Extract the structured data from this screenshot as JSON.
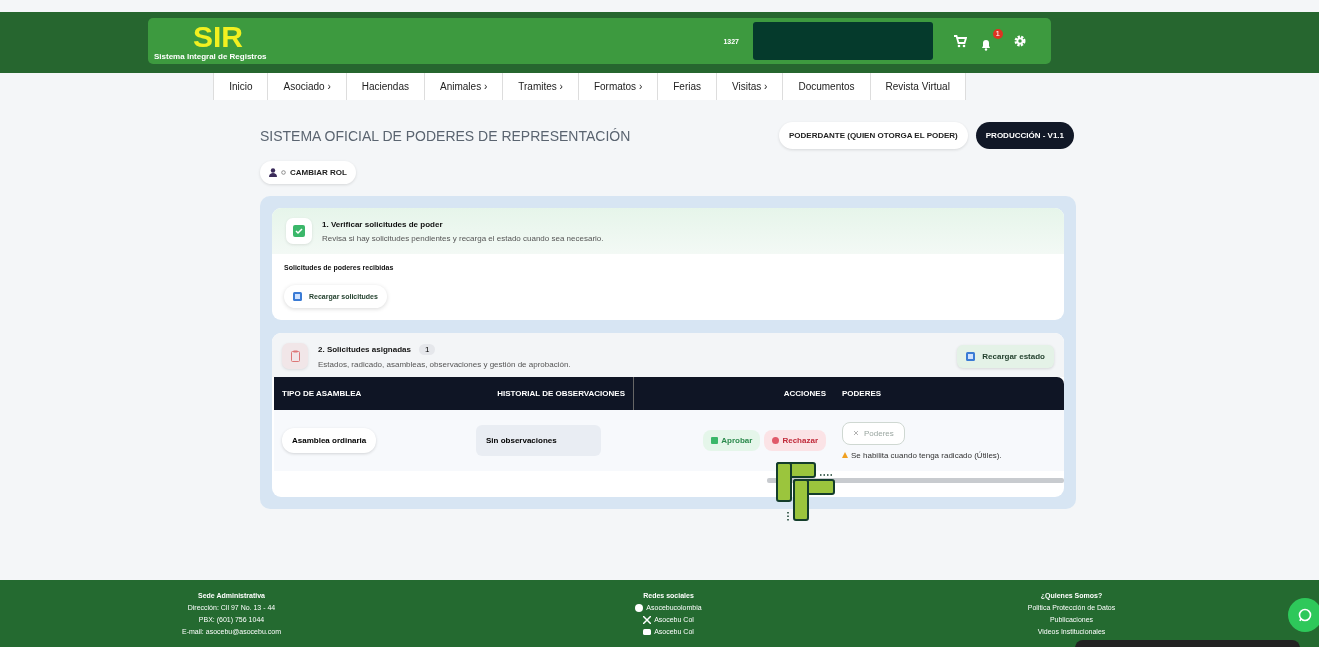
{
  "header": {
    "logo": "SIR",
    "subtitle": "Sistema Integral de Registros",
    "user_code": "1327",
    "notification_count": "1"
  },
  "nav": [
    {
      "label": "Inicio"
    },
    {
      "label": "Asociado ›"
    },
    {
      "label": "Haciendas"
    },
    {
      "label": "Animales ›"
    },
    {
      "label": "Tramites ›"
    },
    {
      "label": "Formatos ›"
    },
    {
      "label": "Ferias"
    },
    {
      "label": "Visitas ›"
    },
    {
      "label": "Documentos"
    },
    {
      "label": "Revista Virtual"
    }
  ],
  "page": {
    "title": "SISTEMA OFICIAL DE PODERES DE REPRESENTACIÓN",
    "role_badge": "PODERDANTE (QUIEN OTORGA EL PODER)",
    "env_badge": "PRODUCCIÓN - V1.1",
    "change_role": "CAMBIAR ROL"
  },
  "step1": {
    "title": "1. Verificar solicitudes de poder",
    "description": "Revisa si hay solicitudes pendientes y recarga el estado cuando sea necesario.",
    "section_label": "Solicitudes de poderes recibidas",
    "reload_button": "Recargar solicitudes"
  },
  "step2": {
    "title": "2. Solicitudes asignadas",
    "count": "1",
    "description": "Estados, radicado, asambleas, observaciones y gestión de aprobación.",
    "reload_button": "Recargar estado",
    "table": {
      "columns": [
        "TIPO DE ASAMBLEA",
        "HISTORIAL DE OBSERVACIONES",
        "ACCIONES",
        "PODERES"
      ],
      "rows": [
        {
          "assembly": "Asamblea ordinaria",
          "observations": "Sin observaciones",
          "approve": "Aprobar",
          "reject": "Rechazar",
          "powers_button": "Poderes",
          "powers_disabled": true,
          "powers_hint": "Se habilita cuando tenga radicado (Útiles)."
        }
      ]
    }
  },
  "footer": {
    "columns": [
      {
        "title": "Sede Administrativa",
        "kind": "text",
        "lines": [
          {
            "text": "Dirección: Cll 97 No. 13 - 44"
          },
          {
            "text": "PBX: (601) 756 1044"
          },
          {
            "text": "E-mail: asocebu@asocebu.com"
          }
        ]
      },
      {
        "title": "Redes sociales",
        "kind": "social",
        "lines": [
          {
            "text": "Asocebucolombia"
          },
          {
            "text": "Asocebu Col"
          },
          {
            "text": "Asocebu Col"
          }
        ]
      },
      {
        "title": "¿Quienes Somos?",
        "kind": "text",
        "lines": [
          {
            "text": "Politica Protección de Datos"
          },
          {
            "text": "Publicaciones"
          },
          {
            "text": "Videos Institucionales"
          }
        ]
      }
    ]
  }
}
